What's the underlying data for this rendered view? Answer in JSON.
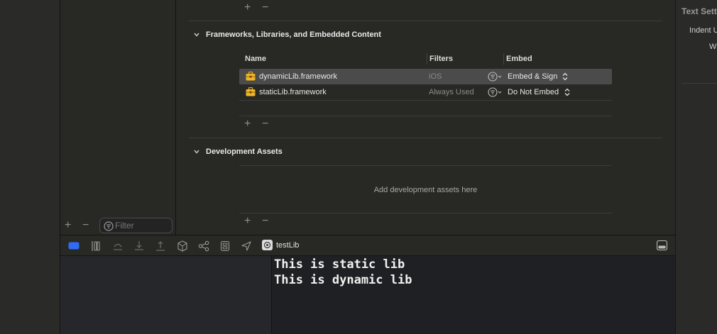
{
  "inspector": {
    "title": "Text Sett",
    "indent_label": "Indent U",
    "width_label": "Wi"
  },
  "navigator": {
    "filter_placeholder": "Filter",
    "add_glyph": "+",
    "remove_glyph": "−"
  },
  "frameworks_section": {
    "title": "Frameworks, Libraries, and Embedded Content",
    "columns": [
      "Name",
      "Filters",
      "Embed"
    ],
    "rows": [
      {
        "name": "dynamicLib.framework",
        "filter": "iOS",
        "embed": "Embed & Sign",
        "selected": true
      },
      {
        "name": "staticLib.framework",
        "filter": "Always Used",
        "embed": "Do Not Embed",
        "selected": false
      }
    ]
  },
  "dev_assets_section": {
    "title": "Development Assets",
    "placeholder": "Add development assets here"
  },
  "debug_bar": {
    "process_name": "testLib",
    "active_color": "#2f6cf6"
  },
  "console": {
    "lines": [
      "This is static lib",
      "This is dynamic lib"
    ]
  },
  "icons": {
    "chevron": "chevron-down-icon",
    "framework": "toolbox-icon",
    "popup": "chevron-up-down-icon"
  }
}
